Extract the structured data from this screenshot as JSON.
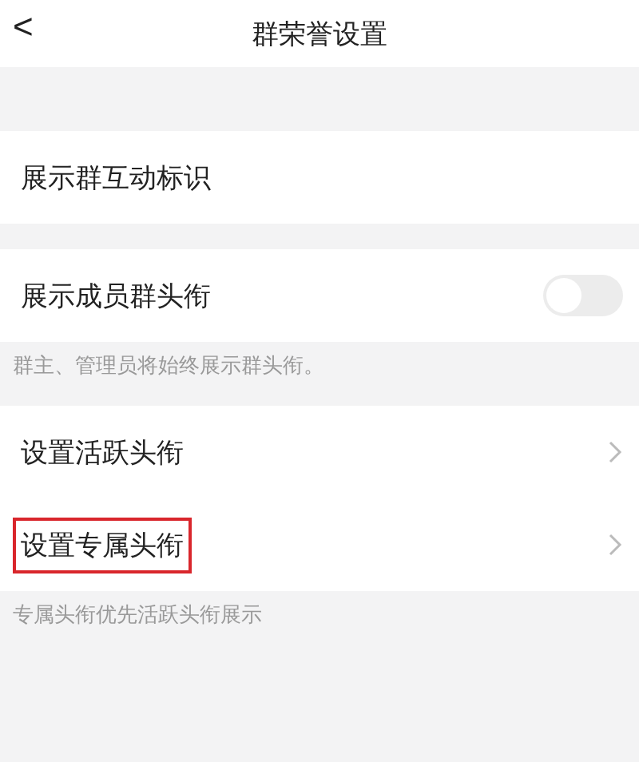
{
  "nav": {
    "back": "<",
    "title": "群荣誉设置"
  },
  "groups": [
    {
      "items": [
        {
          "kind": "plain",
          "label": "展示群互动标识"
        }
      ]
    },
    {
      "items": [
        {
          "kind": "toggle",
          "label": "展示成员群头衔",
          "on": false
        }
      ],
      "hint": "群主、管理员将始终展示群头衔。"
    },
    {
      "items": [
        {
          "kind": "link",
          "label": "设置活跃头衔",
          "highlighted": false
        },
        {
          "kind": "link",
          "label": "设置专属头衔",
          "highlighted": true
        }
      ],
      "hint": "专属头衔优先活跃头衔展示"
    }
  ]
}
